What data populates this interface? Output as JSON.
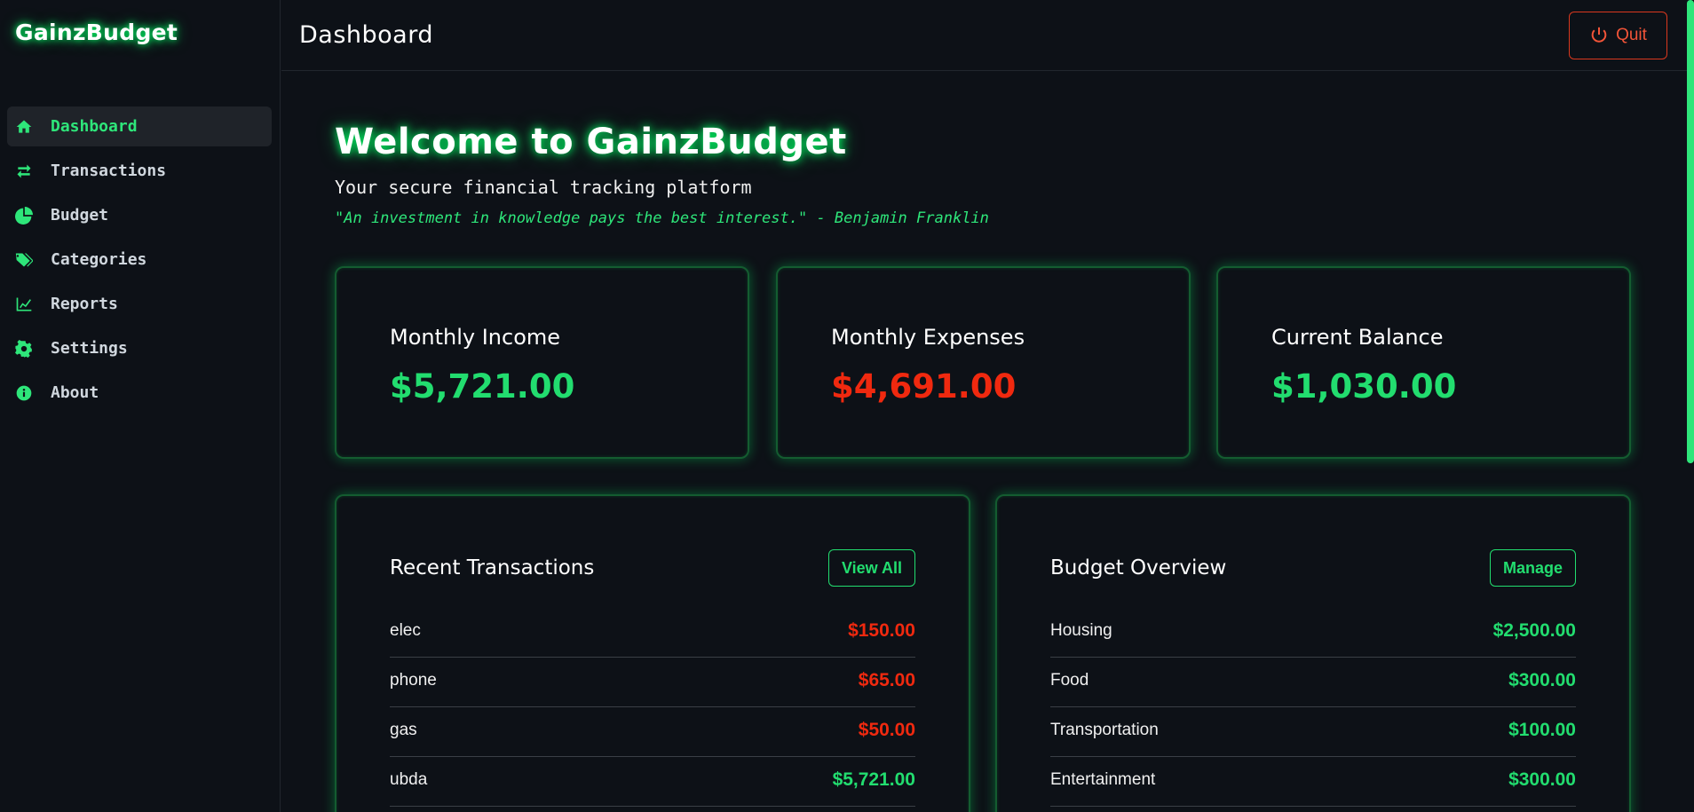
{
  "app": {
    "name": "GainzBudget"
  },
  "sidebar": {
    "items": [
      {
        "label": "Dashboard",
        "icon": "home-icon",
        "active": true
      },
      {
        "label": "Transactions",
        "icon": "exchange-icon",
        "active": false
      },
      {
        "label": "Budget",
        "icon": "pie-chart-icon",
        "active": false
      },
      {
        "label": "Categories",
        "icon": "tags-icon",
        "active": false
      },
      {
        "label": "Reports",
        "icon": "line-chart-icon",
        "active": false
      },
      {
        "label": "Settings",
        "icon": "gear-icon",
        "active": false
      },
      {
        "label": "About",
        "icon": "info-circle-icon",
        "active": false
      }
    ]
  },
  "header": {
    "title": "Dashboard",
    "quit_label": "Quit",
    "quit_icon": "power-icon"
  },
  "welcome": {
    "title": "Welcome to GainzBudget",
    "subtitle": "Your secure financial tracking platform",
    "quote": "\"An investment in knowledge pays the best interest.\" - Benjamin Franklin"
  },
  "stats": {
    "income": {
      "label": "Monthly Income",
      "value": "$5,721.00"
    },
    "expenses": {
      "label": "Monthly Expenses",
      "value": "$4,691.00"
    },
    "balance": {
      "label": "Current Balance",
      "value": "$1,030.00"
    }
  },
  "recent_transactions": {
    "title": "Recent Transactions",
    "button_label": "View All",
    "rows": [
      {
        "name": "elec",
        "amount": "$150.00",
        "type": "expense"
      },
      {
        "name": "phone",
        "amount": "$65.00",
        "type": "expense"
      },
      {
        "name": "gas",
        "amount": "$50.00",
        "type": "expense"
      },
      {
        "name": "ubda",
        "amount": "$5,721.00",
        "type": "income"
      }
    ]
  },
  "budget_overview": {
    "title": "Budget Overview",
    "button_label": "Manage",
    "rows": [
      {
        "name": "Housing",
        "amount": "$2,500.00"
      },
      {
        "name": "Food",
        "amount": "$300.00"
      },
      {
        "name": "Transportation",
        "amount": "$100.00"
      },
      {
        "name": "Entertainment",
        "amount": "$300.00"
      }
    ]
  },
  "colors": {
    "accent": "#2ee67a",
    "income": "#22dd6f",
    "expense": "#f0290f",
    "background": "#0d1117"
  }
}
